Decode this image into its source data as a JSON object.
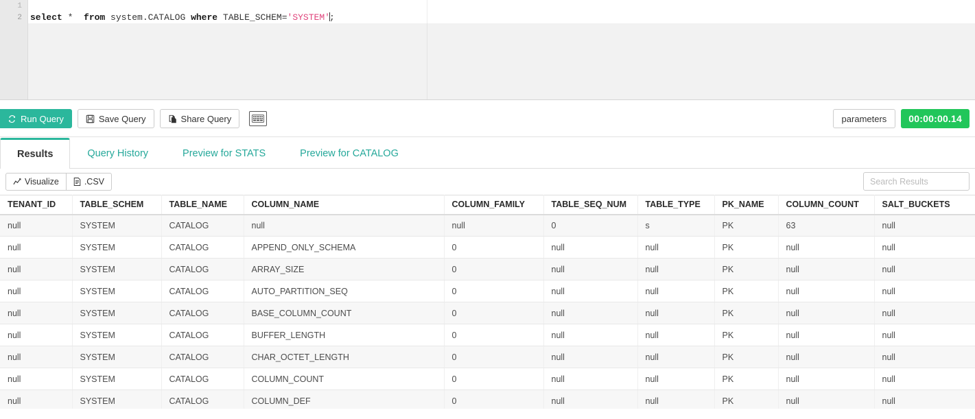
{
  "editor": {
    "line_numbers": [
      "1",
      "2"
    ],
    "sql": {
      "full_text": "select *  from system.CATALOG where TABLE_SCHEM='SYSTEM';",
      "tokens": [
        {
          "t": "select",
          "k": "kw"
        },
        {
          "t": " *  ",
          "k": "plain"
        },
        {
          "t": "from",
          "k": "kw"
        },
        {
          "t": " system.CATALOG ",
          "k": "ident"
        },
        {
          "t": "where",
          "k": "kw"
        },
        {
          "t": " TABLE_SCHEM=",
          "k": "ident"
        },
        {
          "t": "'SYSTEM'",
          "k": "str"
        },
        {
          "t": ";",
          "k": "plain"
        }
      ],
      "parts": {
        "kw_select": "select",
        "star": " *  ",
        "kw_from": "from",
        "table_ref": " system.CATALOG ",
        "kw_where": "where",
        "predicate_col": " TABLE_SCHEM=",
        "predicate_val": "'SYSTEM'",
        "terminator": ";"
      }
    }
  },
  "toolbar": {
    "run_label": "Run Query",
    "save_label": "Save Query",
    "share_label": "Share Query",
    "keyboard_icon": "keyboard-icon",
    "parameters_label": "parameters",
    "timer_value": "00:00:00.14",
    "accent_color": "#2bb79c",
    "timer_color": "#21c65a"
  },
  "tabs": [
    {
      "label": "Results",
      "active": true
    },
    {
      "label": "Query History",
      "active": false
    },
    {
      "label": "Preview for STATS",
      "active": false
    },
    {
      "label": "Preview for CATALOG",
      "active": false
    }
  ],
  "results_bar": {
    "visualize_label": "Visualize",
    "csv_label": ".CSV",
    "search_placeholder": "Search Results",
    "search_value": ""
  },
  "table": {
    "columns": [
      "TENANT_ID",
      "TABLE_SCHEM",
      "TABLE_NAME",
      "COLUMN_NAME",
      "COLUMN_FAMILY",
      "TABLE_SEQ_NUM",
      "TABLE_TYPE",
      "PK_NAME",
      "COLUMN_COUNT",
      "SALT_BUCKETS"
    ],
    "rows": [
      [
        "null",
        "SYSTEM",
        "CATALOG",
        "null",
        "null",
        "0",
        "s",
        "PK",
        "63",
        "null"
      ],
      [
        "null",
        "SYSTEM",
        "CATALOG",
        "APPEND_ONLY_SCHEMA",
        "0",
        "null",
        "null",
        "PK",
        "null",
        "null"
      ],
      [
        "null",
        "SYSTEM",
        "CATALOG",
        "ARRAY_SIZE",
        "0",
        "null",
        "null",
        "PK",
        "null",
        "null"
      ],
      [
        "null",
        "SYSTEM",
        "CATALOG",
        "AUTO_PARTITION_SEQ",
        "0",
        "null",
        "null",
        "PK",
        "null",
        "null"
      ],
      [
        "null",
        "SYSTEM",
        "CATALOG",
        "BASE_COLUMN_COUNT",
        "0",
        "null",
        "null",
        "PK",
        "null",
        "null"
      ],
      [
        "null",
        "SYSTEM",
        "CATALOG",
        "BUFFER_LENGTH",
        "0",
        "null",
        "null",
        "PK",
        "null",
        "null"
      ],
      [
        "null",
        "SYSTEM",
        "CATALOG",
        "CHAR_OCTET_LENGTH",
        "0",
        "null",
        "null",
        "PK",
        "null",
        "null"
      ],
      [
        "null",
        "SYSTEM",
        "CATALOG",
        "COLUMN_COUNT",
        "0",
        "null",
        "null",
        "PK",
        "null",
        "null"
      ],
      [
        "null",
        "SYSTEM",
        "CATALOG",
        "COLUMN_DEF",
        "0",
        "null",
        "null",
        "PK",
        "null",
        "null"
      ]
    ]
  }
}
